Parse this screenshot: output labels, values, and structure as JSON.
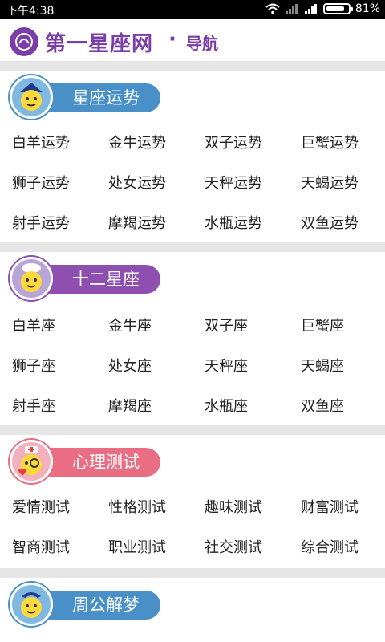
{
  "status": {
    "time": "下午4:38",
    "battery": "81%",
    "wifi_icon": "wifi-icon",
    "signal_icon": "signal-icon"
  },
  "header": {
    "logo": "第一星座网",
    "dot": "·",
    "nav": "导航"
  },
  "colors": {
    "brand": "#7b3ea8",
    "blue": "#4a90c8",
    "purple": "#8e4fb0",
    "pink": "#e96e84"
  },
  "sections": [
    {
      "title": "星座运势",
      "items": [
        "白羊运势",
        "金牛运势",
        "双子运势",
        "巨蟹运势",
        "狮子运势",
        "处女运势",
        "天秤运势",
        "天蝎运势",
        "射手运势",
        "摩羯运势",
        "水瓶运势",
        "双鱼运势"
      ]
    },
    {
      "title": "十二星座",
      "items": [
        "白羊座",
        "金牛座",
        "双子座",
        "巨蟹座",
        "狮子座",
        "处女座",
        "天秤座",
        "天蝎座",
        "射手座",
        "摩羯座",
        "水瓶座",
        "双鱼座"
      ]
    },
    {
      "title": "心理测试",
      "items": [
        "爱情测试",
        "性格测试",
        "趣味测试",
        "财富测试",
        "智商测试",
        "职业测试",
        "社交测试",
        "综合测试"
      ]
    },
    {
      "title": "周公解梦",
      "items": []
    }
  ]
}
